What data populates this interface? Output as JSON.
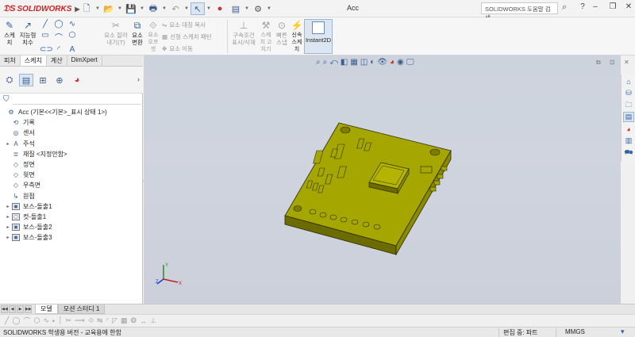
{
  "app": {
    "brand": "SOLIDWORKS",
    "document_title": "Acc",
    "search_placeholder": "SOLIDWORKS 도움말 검색"
  },
  "ribbon": {
    "sketch": "스케\n치",
    "smart_dim": "지능형\n치수",
    "trim": "요소 잘라\n내기(T)",
    "convert": "요소\n변환",
    "offset": "요소\n오프\n셋",
    "mirror": "요소 대칭 복사",
    "linear_pattern": "선형 스케치 패턴",
    "move": "요소 이동",
    "relations": "구속조건\n표시/삭제",
    "repair": "스케\n치 고\n치기",
    "quick_snaps": "빠른\n스냅",
    "rapid_sketch": "신속\n스케\n치",
    "instant2d": "Instant2D"
  },
  "tabs": [
    "피처",
    "스케치",
    "계산",
    "DimXpert"
  ],
  "active_tab_index": 1,
  "tree": [
    {
      "label": "Acc  (기본<<기본>_표시 상태 1>)",
      "icon": "part-icon",
      "expand": ""
    },
    {
      "label": "기록",
      "icon": "history-icon",
      "expand": ""
    },
    {
      "label": "센서",
      "icon": "sensor-icon",
      "expand": ""
    },
    {
      "label": "주석",
      "icon": "annotation-icon",
      "expand": "▸"
    },
    {
      "label": "재질 <지정안함>",
      "icon": "material-icon",
      "expand": ""
    },
    {
      "label": "정면",
      "icon": "plane-icon",
      "expand": ""
    },
    {
      "label": "윗면",
      "icon": "plane-icon",
      "expand": ""
    },
    {
      "label": "우측면",
      "icon": "plane-icon",
      "expand": ""
    },
    {
      "label": "원점",
      "icon": "origin-icon",
      "expand": ""
    },
    {
      "label": "보스-돌출1",
      "icon": "boss-extrude-icon",
      "expand": "▸"
    },
    {
      "label": "컷-돌출1",
      "icon": "cut-extrude-icon",
      "expand": "▸"
    },
    {
      "label": "보스-돌출2",
      "icon": "boss-extrude-icon",
      "expand": "▸"
    },
    {
      "label": "보스-돌출3",
      "icon": "boss-extrude-icon",
      "expand": "▸"
    }
  ],
  "model_tabs": [
    "모델",
    "모션 스터디 1"
  ],
  "status": {
    "left": "SOLIDWORKS 학생용 버전 - 교육용에 한함",
    "mode": "편집 중: 파트",
    "units": "MMGS"
  },
  "colors": {
    "part_top": "#a6a600",
    "part_side_front": "#6b6b00",
    "part_side_right": "#8a8a00",
    "edge": "#2b2b00",
    "viewport_bg": "#cdd3dd",
    "accent": "#2f5f9f"
  }
}
